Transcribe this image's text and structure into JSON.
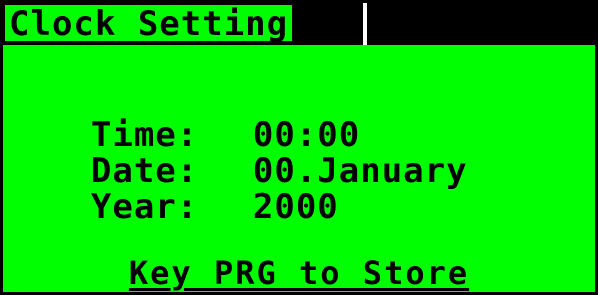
{
  "screen": {
    "title": "Clock Setting",
    "colors": {
      "background": "#00ff00",
      "foreground": "#000000"
    }
  },
  "fields": {
    "time_label": "Time:",
    "time_value": "00:00",
    "date_label": "Date:",
    "date_value": "00.January",
    "year_label": "Year:",
    "year_value": "2000"
  },
  "footer": {
    "hint": "Key PRG to Store"
  }
}
